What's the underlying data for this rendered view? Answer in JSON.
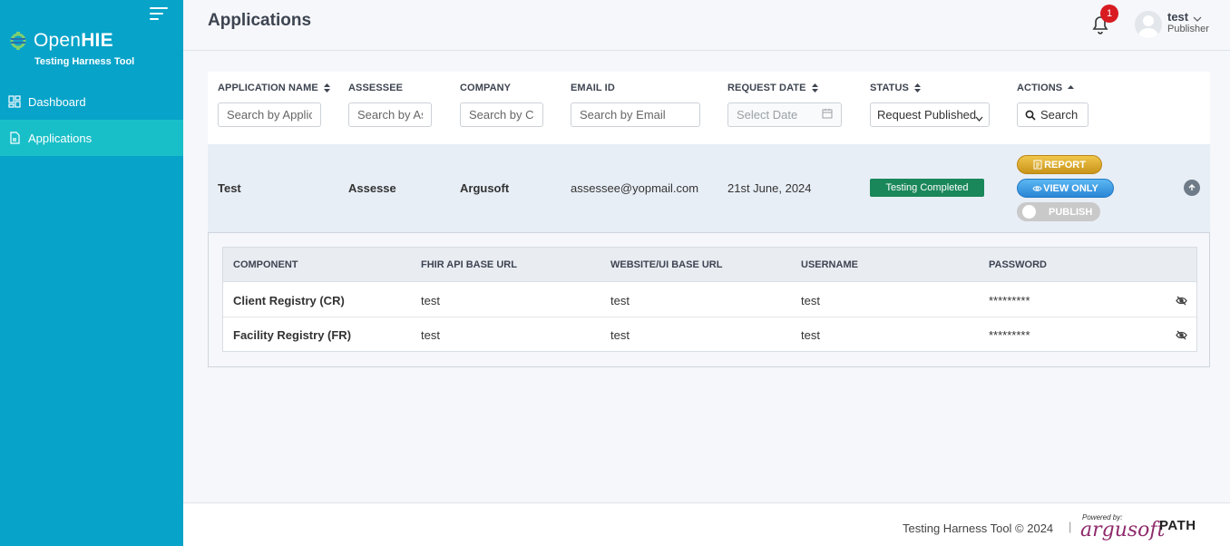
{
  "sidebar": {
    "logo_open": "Open",
    "logo_hie": "HIE",
    "logo_sub": "Testing Harness Tool",
    "items": [
      {
        "label": "Dashboard",
        "icon": "dashboard-icon"
      },
      {
        "label": "Applications",
        "icon": "document-icon",
        "active": true
      }
    ]
  },
  "header": {
    "title": "Applications",
    "notifications": "1",
    "user_name": "test",
    "user_role": "Publisher"
  },
  "table": {
    "columns": {
      "app_name": "APPLICATION NAME",
      "assessee": "ASSESSEE",
      "company": "COMPANY",
      "email": "EMAIL ID",
      "request_date": "REQUEST DATE",
      "status": "STATUS",
      "actions": "ACTIONS"
    },
    "filters": {
      "app_name": "Search by Application",
      "assessee": "Search by Assessee",
      "company": "Search by Company",
      "email": "Search by Email",
      "request_date": "Select Date",
      "status": "Request Published",
      "search_button": "Search"
    },
    "row": {
      "app_name": "Test",
      "assessee": "Assesse",
      "company": "Argusoft",
      "email": "assessee@yopmail.com",
      "request_date": "21st June, 2024",
      "status": "Testing Completed",
      "report_label": "REPORT",
      "view_label": "VIEW ONLY",
      "publish_label": "PUBLISH"
    }
  },
  "components": {
    "columns": {
      "component": "COMPONENT",
      "fhir": "FHIR API BASE URL",
      "website": "WEBSITE/UI BASE URL",
      "username": "USERNAME",
      "password": "PASSWORD"
    },
    "rows": [
      {
        "component": "Client Registry (CR)",
        "fhir": "test",
        "website": "test",
        "username": "test",
        "password": "*********"
      },
      {
        "component": "Facility Registry (FR)",
        "fhir": "test",
        "website": "test",
        "username": "test",
        "password": "*********"
      }
    ]
  },
  "footer": {
    "text": "Testing Harness Tool © 2024",
    "separator": "|",
    "powered_by": "Powered by:",
    "argusoft": "argusoft",
    "path": "PATH"
  },
  "colors": {
    "sidebar": "#07a3c9",
    "sidebar_active": "#19bfc8",
    "status_green": "#19875a",
    "badge_red": "#d81b21"
  }
}
